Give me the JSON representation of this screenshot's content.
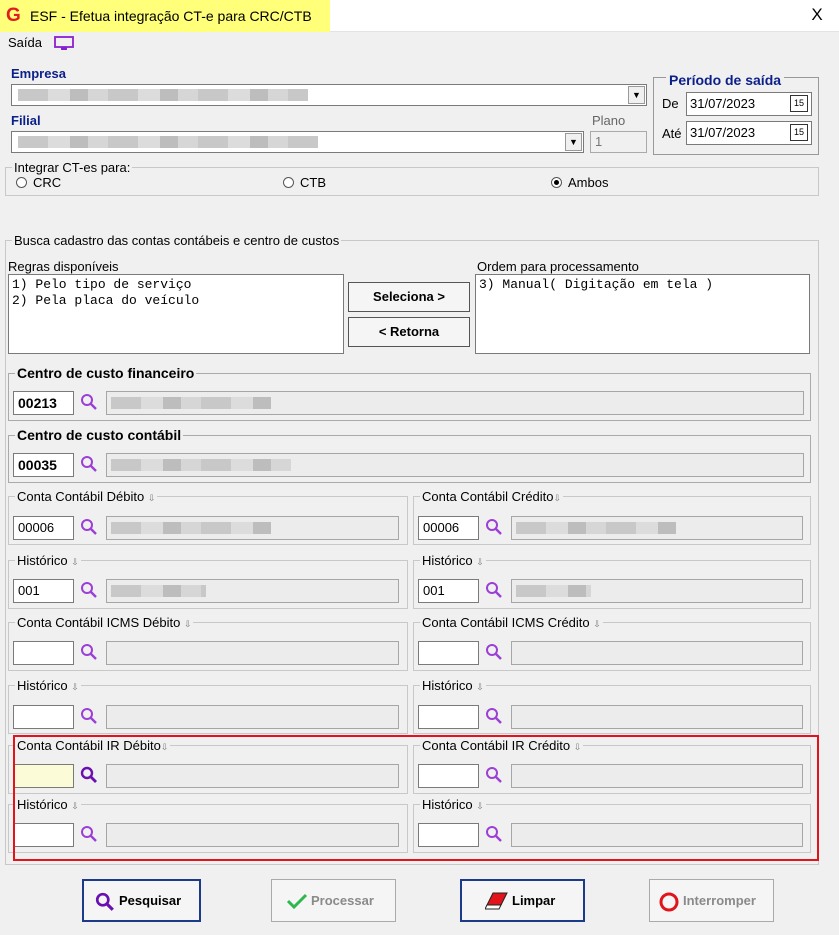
{
  "window": {
    "title": "ESF - Efetua integração CT-e para CRC/CTB",
    "close_glyph": "X",
    "logo_letter": "G"
  },
  "menu": {
    "saida": "Saída"
  },
  "empresa": {
    "label": "Empresa"
  },
  "filial": {
    "label": "Filial"
  },
  "plano": {
    "label": "Plano",
    "value": "1"
  },
  "periodo": {
    "title": "Período de saída",
    "de_label": "De",
    "de_value": "31/07/2023",
    "ate_label": "Até",
    "ate_value": "31/07/2023",
    "cal_glyph": "15"
  },
  "integrar": {
    "legend": "Integrar CT-es para:",
    "options": [
      "CRC",
      "CTB",
      "Ambos"
    ],
    "selected": "Ambos"
  },
  "busca": {
    "legend": "Busca cadastro das contas contábeis e centro de custos",
    "regras_label": "Regras disponíveis",
    "regras": [
      "1) Pelo tipo de serviço",
      "2) Pela placa do veículo"
    ],
    "ordem_label": "Ordem para processamento",
    "ordem": [
      "3) Manual( Digitação em tela )"
    ],
    "seleciona_btn": "Seleciona >",
    "retorna_btn": "< Retorna"
  },
  "centro_financeiro": {
    "legend": "Centro de custo financeiro",
    "code": "00213"
  },
  "centro_contabil": {
    "legend": "Centro de custo contábil",
    "code": "00035"
  },
  "conta_debito": {
    "legend": "Conta Contábil Débito",
    "code": "00006"
  },
  "conta_credito": {
    "legend": "Conta Contábil Crédito",
    "code": "00006"
  },
  "historico_debito": {
    "legend": "Histórico",
    "code": "001"
  },
  "historico_credito": {
    "legend": "Histórico",
    "code": "001"
  },
  "icms_debito": {
    "legend": "Conta Contábil ICMS Débito",
    "code": ""
  },
  "icms_credito": {
    "legend": "Conta Contábil ICMS Crédito",
    "code": ""
  },
  "historico_icms_debito": {
    "legend": "Histórico",
    "code": ""
  },
  "historico_icms_credito": {
    "legend": "Histórico",
    "code": ""
  },
  "ir_debito": {
    "legend": "Conta Contábil IR Débito",
    "code": ""
  },
  "ir_credito": {
    "legend": "Conta Contábil IR Crédito",
    "code": ""
  },
  "historico_ir_debito": {
    "legend": "Histórico",
    "code": ""
  },
  "historico_ir_credito": {
    "legend": "Histórico",
    "code": ""
  },
  "buttons": {
    "pesquisar": "Pesquisar",
    "processar": "Processar",
    "limpar": "Limpar",
    "interromper": "Interromper"
  },
  "colors": {
    "title_highlight": "#ffff7a",
    "label_blue": "#0a1f8a",
    "search_icon": "#9b3fd6",
    "annotation_red": "#e0141a"
  },
  "icons": {
    "logo": "logo-g-icon",
    "monitor": "monitor-icon",
    "search": "magnifier-icon",
    "calendar": "calendar-icon",
    "check": "check-icon",
    "eraser": "eraser-icon",
    "stop": "stop-icon"
  }
}
